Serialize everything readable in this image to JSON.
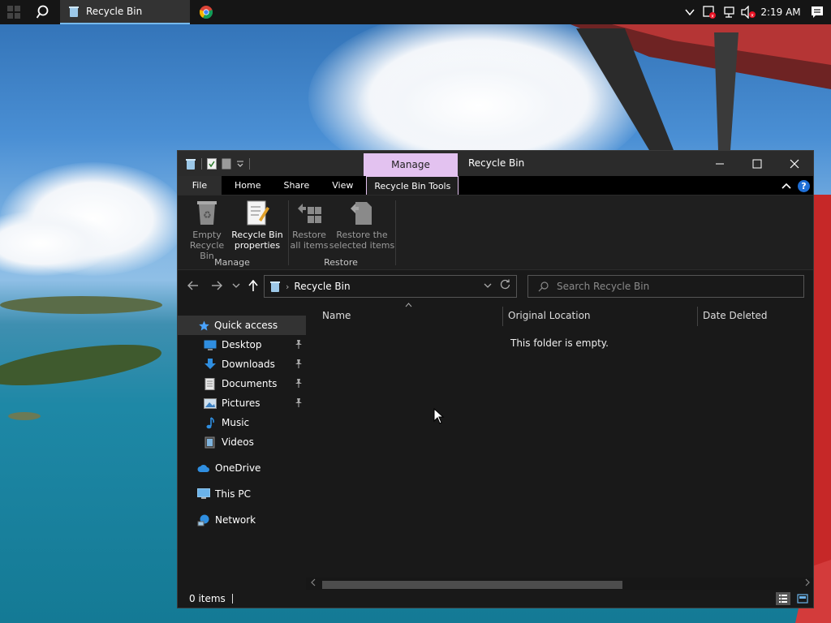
{
  "taskbar": {
    "task_label": "Recycle Bin",
    "clock": "2:19 AM"
  },
  "window": {
    "title": "Recycle Bin",
    "contextual_tab": "Manage"
  },
  "ribbon_tabs": [
    "File",
    "Home",
    "Share",
    "View",
    "Recycle Bin Tools"
  ],
  "ribbon": {
    "manage_group": {
      "label": "Manage",
      "empty_line1": "Empty",
      "empty_line2": "Recycle Bin",
      "properties_line1": "Recycle Bin",
      "properties_line2": "properties"
    },
    "restore_group": {
      "label": "Restore",
      "restore_all_line1": "Restore",
      "restore_all_line2": "all items",
      "restore_sel_line1": "Restore the",
      "restore_sel_line2": "selected items"
    }
  },
  "address": {
    "path": "Recycle Bin",
    "search_placeholder": "Search Recycle Bin"
  },
  "nav": {
    "quick_access": "Quick access",
    "items": [
      "Desktop",
      "Downloads",
      "Documents",
      "Pictures",
      "Music",
      "Videos"
    ],
    "onedrive": "OneDrive",
    "this_pc": "This PC",
    "network": "Network"
  },
  "columns": {
    "name": "Name",
    "original_location": "Original Location",
    "date_deleted": "Date Deleted"
  },
  "content": {
    "empty_message": "This folder is empty."
  },
  "status": {
    "item_count": "0 items"
  },
  "colors": {
    "accent_manage": "#e3c2f0",
    "window_bg": "#191919",
    "taskbar_bg": "#151515",
    "quick_access_star": "#4aa3ff"
  }
}
